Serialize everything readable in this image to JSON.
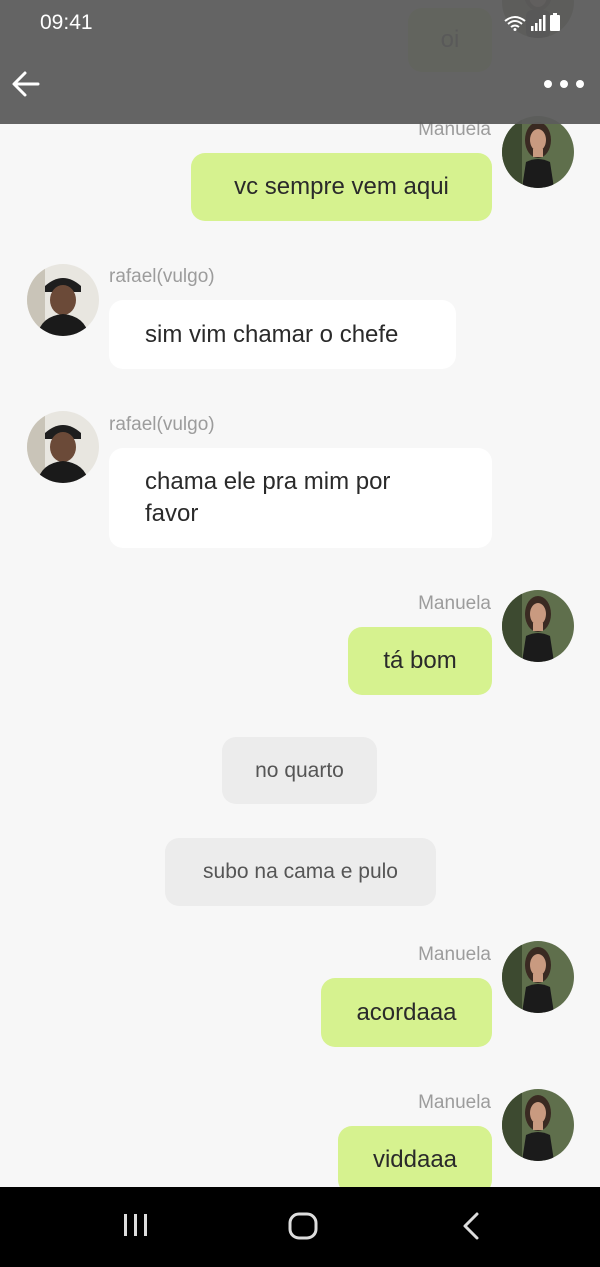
{
  "status_bar": {
    "time": "09:41"
  },
  "top_snippet": {
    "text": "oi"
  },
  "messages": [
    {
      "sender": "Manuela",
      "text": "vc sempre vem aqui"
    },
    {
      "sender": "rafael(vulgo)",
      "text": "sim vim chamar o chefe"
    },
    {
      "sender": "rafael(vulgo)",
      "text": "chama ele pra mim por favor"
    },
    {
      "sender": "Manuela",
      "text": "tá bom"
    },
    {
      "text": "no quarto"
    },
    {
      "text": "subo na cama e pulo"
    },
    {
      "sender": "Manuela",
      "text": "acordaaa"
    },
    {
      "sender": "Manuela",
      "text": "viddaaa"
    }
  ],
  "icons": {
    "back": "arrow-left-icon",
    "more": "more-options-icon",
    "wifi": "wifi-icon",
    "signal": "signal-icon",
    "battery": "battery-icon",
    "recent_apps": "recent-apps-icon",
    "home": "home-icon",
    "nav_back": "chevron-left-icon"
  },
  "colors": {
    "my_bubble": "#d6f28f",
    "other_bubble": "#ffffff",
    "narration_bubble": "#ececec",
    "top_bar": "#5c5c5c",
    "nav_bar": "#000000"
  }
}
